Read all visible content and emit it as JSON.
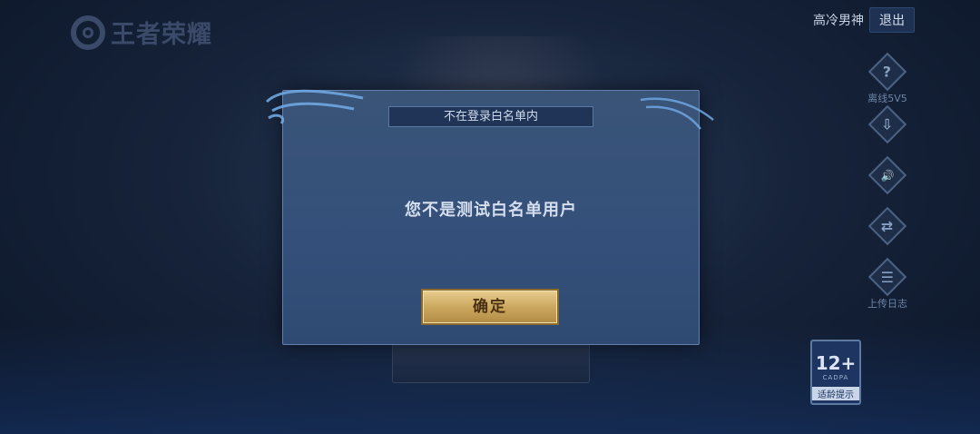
{
  "app": {
    "logo_text": "王者荣耀"
  },
  "header": {
    "username": "高冷男神",
    "logout_label": "退出"
  },
  "side_tools": [
    {
      "icon": "question-icon",
      "glyph": "?",
      "label": "离线5V5"
    },
    {
      "icon": "download-icon",
      "glyph": "⇩",
      "label": ""
    },
    {
      "icon": "speaker-icon",
      "glyph": "🔊",
      "label": ""
    },
    {
      "icon": "switch-account-icon",
      "glyph": "⇄",
      "label": ""
    },
    {
      "icon": "clipboard-icon",
      "glyph": "☰",
      "label": "上传日志"
    }
  ],
  "dialog": {
    "title": "不在登录白名单内",
    "message": "您不是测试白名单用户",
    "confirm_label": "确定"
  },
  "age_rating": {
    "age": "12+",
    "org": "CADPA",
    "tip": "适龄提示"
  },
  "colors": {
    "accent_gold": "#c9a55c",
    "dialog_bg": "#34507a"
  }
}
